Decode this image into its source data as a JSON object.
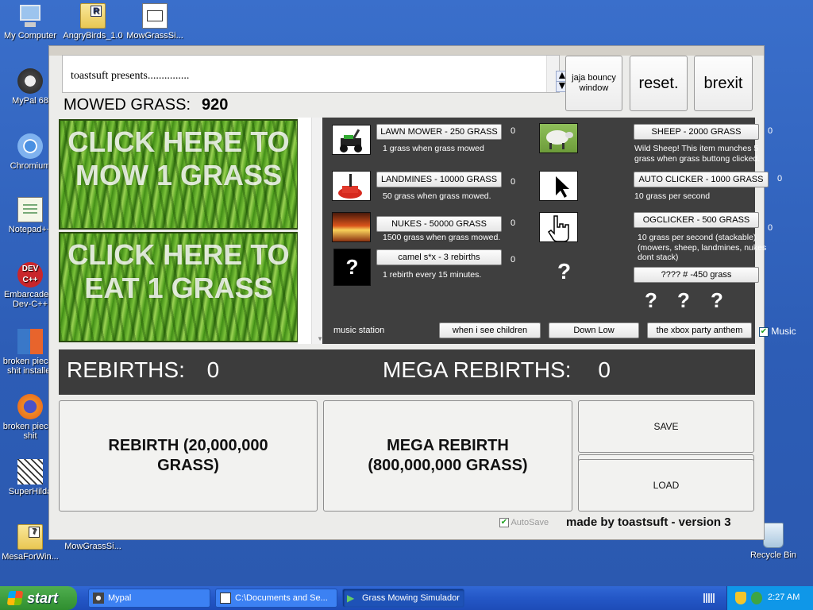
{
  "desktop": {
    "icons": [
      {
        "label": "My Computer"
      },
      {
        "label": "AngryBirds_1.0"
      },
      {
        "label": "MowGrassSi..."
      },
      {
        "label": "MyPal 68"
      },
      {
        "label": "Chromium"
      },
      {
        "label": "Notepad++"
      },
      {
        "label": "Embarcadero Dev-C++"
      },
      {
        "label": "broken pieces shit installer"
      },
      {
        "label": "broken pieces shit"
      },
      {
        "label": "SuperHilda"
      },
      {
        "label": "MesaForWin..."
      },
      {
        "label": "MowGrassSi..."
      },
      {
        "label": "Recycle Bin"
      }
    ]
  },
  "app": {
    "ticker_text": "toastsuft presents...............",
    "top_buttons": {
      "bouncy": "jaja bouncy window",
      "reset": "reset.",
      "brexit": "brexit"
    },
    "mowed_label": "MOWED GRASS:",
    "mowed_value": "920",
    "mow_button": "CLICK HERE TO MOW 1 GRASS",
    "eat_button": "CLICK HERE TO EAT 1 GRASS",
    "shop": {
      "items": [
        {
          "button": "LAWN MOWER - 250 GRASS",
          "count": "0",
          "desc": "1 grass when grass mowed",
          "icon": "lawn-mower"
        },
        {
          "button": "LANDMINES - 10000 GRASS",
          "count": "0",
          "desc": "50 grass when grass mowed.",
          "icon": "landmine"
        },
        {
          "button": "NUKES - 50000 GRASS",
          "count": "0",
          "desc": "1500 grass when grass mowed.",
          "icon": "explosion"
        },
        {
          "button": "camel s*x - 3 rebirths",
          "count": "0",
          "desc": "1 rebirth every 15 minutes.",
          "icon": "question",
          "thumb_text": "?"
        },
        {
          "button": "SHEEP - 2000 GRASS",
          "count": "0",
          "desc": "Wild Sheep! This item munches 5 grass when grass buttong clicked.",
          "icon": "sheep"
        },
        {
          "button": "AUTO CLICKER - 1000 GRASS",
          "count": "0",
          "desc": "10 grass per second",
          "icon": "cursor-arrow"
        },
        {
          "button": "OGCLICKER - 500 GRASS",
          "count": "0",
          "desc": "10 grass per second (stackable) (mowers, sheep, landmines, nukes dont stack)",
          "icon": "hand-cursor"
        },
        {
          "button": "???? # -450 grass",
          "icon": "question",
          "thumb_text": "?"
        }
      ],
      "mystery": [
        "?",
        "?",
        "?"
      ],
      "music_label": "music station",
      "music_buttons": [
        "when i see children",
        "Down Low",
        "the xbox party anthem"
      ],
      "music_checkbox": "Music",
      "music_checked": true
    },
    "rebirths_label": "REBIRTHS:",
    "rebirths_value": "0",
    "mega_label": "MEGA REBIRTHS:",
    "mega_value": "0",
    "rebirth_button": "REBIRTH (20,000,000 GRASS)",
    "mega_button": "MEGA REBIRTH (800,000,000 GRASS)",
    "save_button": "SAVE",
    "load_button": "LOAD",
    "autosave_label": "AutoSave",
    "autosave_checked": true,
    "credits": "made by toastsuft - version 3"
  },
  "taskbar": {
    "start": "start",
    "tasks": [
      {
        "label": "Mypal"
      },
      {
        "label": "C:\\Documents and Se..."
      },
      {
        "label": "Grass Mowing Simulador",
        "active": true
      }
    ],
    "clock": "2:27 AM"
  }
}
